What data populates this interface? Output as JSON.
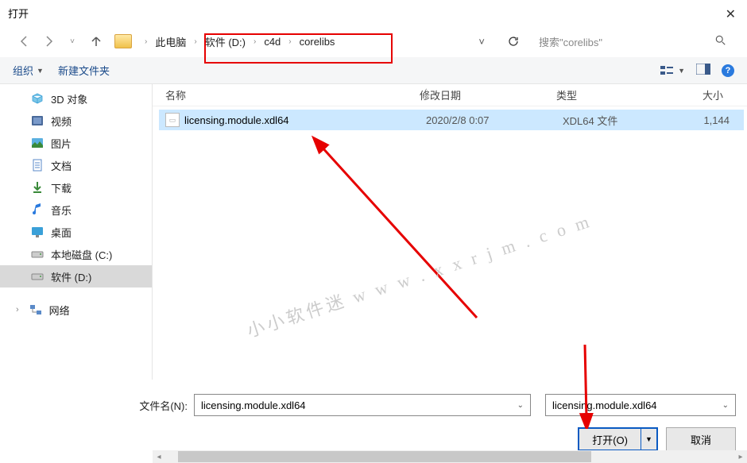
{
  "window": {
    "title": "打开"
  },
  "breadcrumb": {
    "root": "此电脑",
    "drive": "软件 (D:)",
    "folder1": "c4d",
    "folder2": "corelibs"
  },
  "search": {
    "placeholder": "搜索\"corelibs\""
  },
  "toolbar": {
    "organize": "组织",
    "newfolder": "新建文件夹"
  },
  "sidebar": {
    "items": [
      {
        "label": "3D 对象"
      },
      {
        "label": "视频"
      },
      {
        "label": "图片"
      },
      {
        "label": "文档"
      },
      {
        "label": "下载"
      },
      {
        "label": "音乐"
      },
      {
        "label": "桌面"
      },
      {
        "label": "本地磁盘 (C:)"
      },
      {
        "label": "软件 (D:)"
      }
    ],
    "network": "网络"
  },
  "columns": {
    "name": "名称",
    "date": "修改日期",
    "type": "类型",
    "size": "大小"
  },
  "file": {
    "name": "licensing.module.xdl64",
    "date": "2020/2/8 0:07",
    "type": "XDL64 文件",
    "size": "1,144"
  },
  "footer": {
    "filename_label": "文件名(N):",
    "filename_value": "licensing.module.xdl64",
    "filter_value": "licensing.module.xdl64",
    "open": "打开(O)",
    "cancel": "取消"
  },
  "watermark": "小小软件迷   w w w . x x r j m . c o m"
}
